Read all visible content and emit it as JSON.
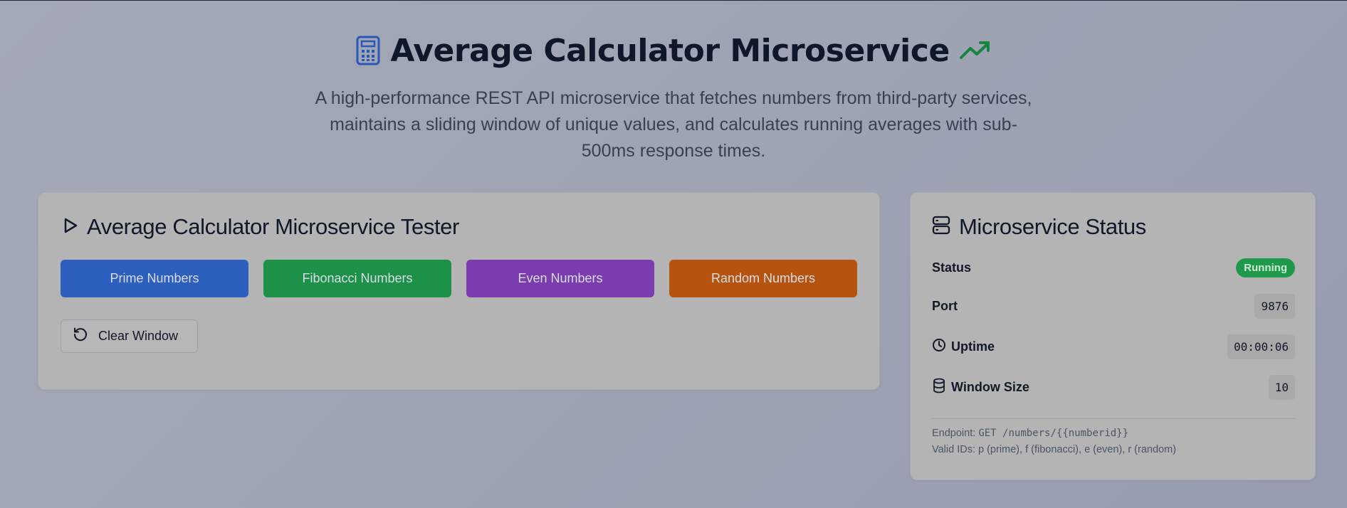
{
  "header": {
    "title": "Average Calculator Microservice",
    "subtitle": "A high-performance REST API microservice that fetches numbers from third-party services, maintains a sliding window of unique values, and calculates running averages with sub-500ms response times.",
    "icons": {
      "left": "calculator-icon",
      "right": "trending-up-icon"
    }
  },
  "tester": {
    "title": "Average Calculator Microservice Tester",
    "icon": "play-icon",
    "buttons": [
      {
        "label": "Prime Numbers",
        "color": "#2c5fbe"
      },
      {
        "label": "Fibonacci Numbers",
        "color": "#1d9147"
      },
      {
        "label": "Even Numbers",
        "color": "#7b3cb0"
      },
      {
        "label": "Random Numbers",
        "color": "#b6530f"
      }
    ],
    "clear_label": "Clear Window",
    "clear_icon": "rotate-ccw-icon"
  },
  "status": {
    "title": "Microservice Status",
    "icon": "server-icon",
    "rows": {
      "status": {
        "label": "Status",
        "value": "Running",
        "color": "#1f9a4c"
      },
      "port": {
        "label": "Port",
        "value": "9876"
      },
      "uptime": {
        "label": "Uptime",
        "value": "00:00:06",
        "icon": "clock-icon"
      },
      "window": {
        "label": "Window Size",
        "value": "10",
        "icon": "database-icon"
      }
    },
    "endpoint_label": "Endpoint:",
    "endpoint_value": "GET /numbers/{{numberid}}",
    "valid_ids": "Valid IDs: p (prime), f (fibonacci), e (even), r (random)"
  }
}
